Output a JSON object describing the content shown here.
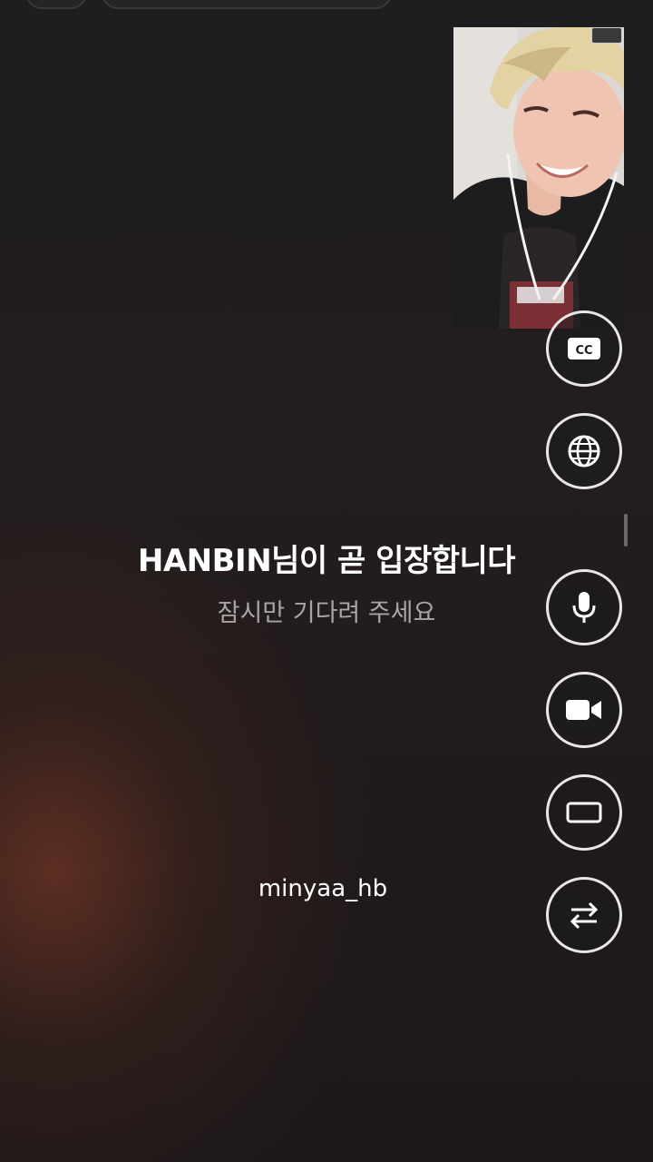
{
  "waiting": {
    "title": "HANBIN님이 곧 입장합니다",
    "subtitle": "잠시만 기다려 주세요"
  },
  "watermark": "minyaa_hb",
  "controls": [
    {
      "name": "captions-button",
      "icon": "cc-icon"
    },
    {
      "name": "translate-button",
      "icon": "globe-icon"
    },
    {
      "name": "microphone-button",
      "icon": "microphone-icon"
    },
    {
      "name": "camera-button",
      "icon": "video-camera-icon"
    },
    {
      "name": "screen-ratio-button",
      "icon": "rectangle-icon"
    },
    {
      "name": "switch-camera-button",
      "icon": "swap-arrows-icon"
    }
  ],
  "colors": {
    "accent_ring": "#e9e6e6",
    "background": "#1c1819",
    "glow": "#6e3424"
  }
}
